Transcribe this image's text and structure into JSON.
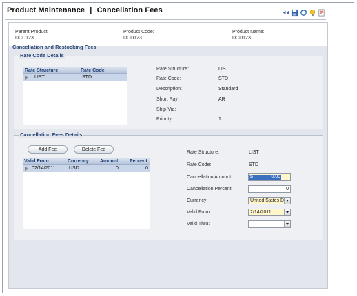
{
  "window": {
    "title": "Product Maintenance",
    "title_separator": "|",
    "subtitle": "Cancellation Fees"
  },
  "toolbar": {
    "icons": [
      "back-arrows-icon",
      "save-disk-icon",
      "refresh-icon",
      "lightbulb-icon",
      "report-icon"
    ]
  },
  "header": {
    "parent_product_label": "Parent Product:",
    "parent_product_value": "DCD123",
    "product_code_label": "Product Code:",
    "product_code_value": "DCD123",
    "product_name_label": "Product Name:",
    "product_name_value": "DCD123"
  },
  "main_section_title": "Cancellation and Restocking Fees",
  "rate_code": {
    "title": "Rate Code Details",
    "columns": [
      "Rate Structure",
      "Rate Code"
    ],
    "rows": [
      {
        "rate_structure": "LIST",
        "rate_code": "STD"
      }
    ],
    "details": {
      "rate_structure_label": "Rate Structure:",
      "rate_structure_value": "LIST",
      "rate_code_label": "Rate Code:",
      "rate_code_value": "STD",
      "description_label": "Description:",
      "description_value": "Standard",
      "short_pay_label": "Short Pay:",
      "short_pay_value": "AR",
      "ship_via_label": "Ship-Via:",
      "ship_via_value": "",
      "priority_label": "Priority:",
      "priority_value": "1"
    }
  },
  "fees": {
    "title": "Cancellation Fees Details",
    "add_fee_label": "Add Fee",
    "delete_fee_label": "Delete Fee",
    "columns": [
      "Valid From",
      "Currency",
      "Amount",
      "Percent"
    ],
    "rows": [
      {
        "valid_from": "02/14/2011",
        "currency": "USD",
        "amount": "0",
        "percent": "0"
      }
    ],
    "form": {
      "rate_structure_label": "Rate Structure:",
      "rate_structure_value": "LIST",
      "rate_code_label": "Rate Code:",
      "rate_code_value": "STD",
      "cancellation_amount_label": "Cancellation Amount:",
      "cancellation_amount_currency": "$",
      "cancellation_amount_value": "0.00",
      "cancellation_percent_label": "Cancellation Percent:",
      "cancellation_percent_value": "0",
      "currency_label": "Currency:",
      "currency_value": "United States D",
      "valid_from_label": "Valid From:",
      "valid_from_value": "2/14/2011",
      "valid_thru_label": "Valid Thru:",
      "valid_thru_value": ""
    }
  },
  "colors": {
    "header_text": "#2a4a7a",
    "selected_row": "#c9d6e9",
    "required_field": "#fff6cc",
    "panel_bg": "#e3e6ec"
  }
}
